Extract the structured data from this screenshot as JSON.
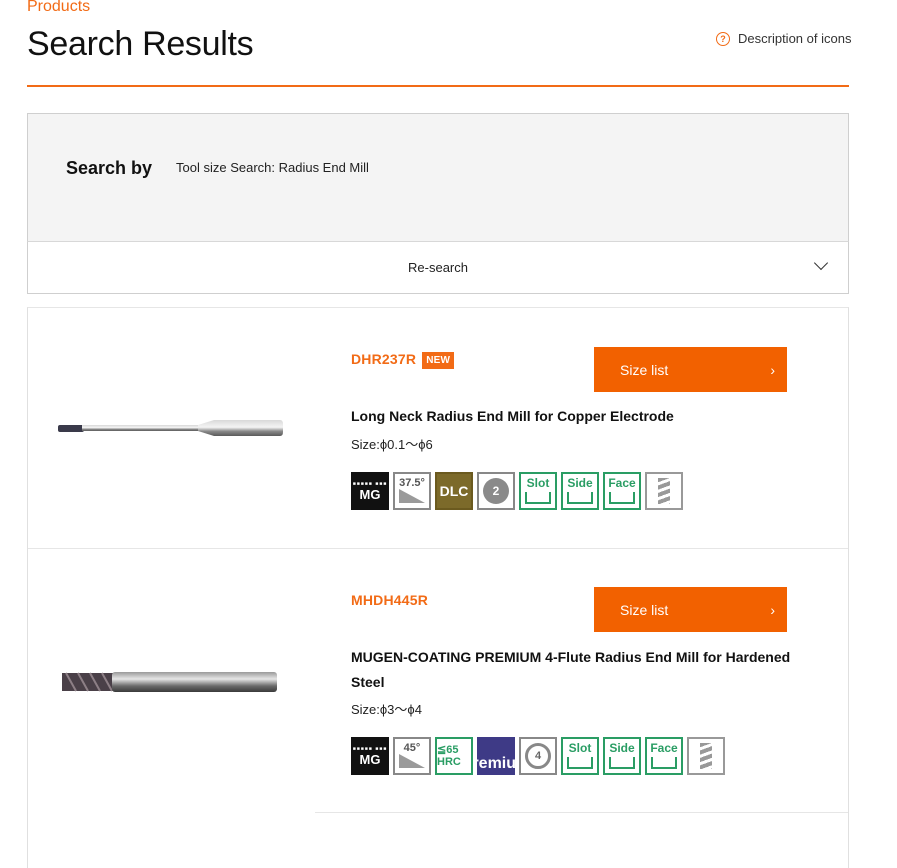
{
  "header": {
    "breadcrumb": "Products",
    "title": "Search Results",
    "icon_help_label": "Description of icons"
  },
  "search": {
    "label": "Search by",
    "value": "Tool size Search: Radius End Mill",
    "research_label": "Re-search"
  },
  "products": [
    {
      "code": "DHR237R",
      "badge": "NEW",
      "button_label": "Size list",
      "name": "Long Neck Radius End Mill for Copper Electrode",
      "size": "Size:ϕ0.1～ϕ6",
      "icons": [
        {
          "name": "mg-icon",
          "text": "MG"
        },
        {
          "name": "helix-angle-37-5-icon",
          "text": "37.5°"
        },
        {
          "name": "dlc-coating-icon",
          "text": "DLC"
        },
        {
          "name": "two-flute-icon",
          "text": "2"
        },
        {
          "name": "slot-icon",
          "text": "Slot"
        },
        {
          "name": "side-icon",
          "text": "Side"
        },
        {
          "name": "face-icon",
          "text": "Face"
        },
        {
          "name": "end-mill-shape-icon",
          "text": ""
        }
      ]
    },
    {
      "code": "MHDH445R",
      "badge": "",
      "button_label": "Size list",
      "name": "MUGEN-COATING PREMIUM 4-Flute Radius End Mill for Hardened Steel",
      "size": "Size:ϕ3～ϕ4",
      "icons": [
        {
          "name": "mg-icon",
          "text": "MG"
        },
        {
          "name": "helix-angle-45-icon",
          "text": "45°"
        },
        {
          "name": "hrc-65-icon",
          "text": "≦65 HRC"
        },
        {
          "name": "premium-coating-icon",
          "text": "∞ Premium"
        },
        {
          "name": "four-flute-icon",
          "text": "4"
        },
        {
          "name": "slot-icon",
          "text": "Slot"
        },
        {
          "name": "side-icon",
          "text": "Side"
        },
        {
          "name": "face-icon",
          "text": "Face"
        },
        {
          "name": "end-mill-shape-icon",
          "text": ""
        }
      ]
    }
  ],
  "colors": {
    "accent": "#f26b16",
    "button": "#f26100",
    "icon_green": "#2a9d64",
    "premium_purple": "#3e3a86"
  }
}
